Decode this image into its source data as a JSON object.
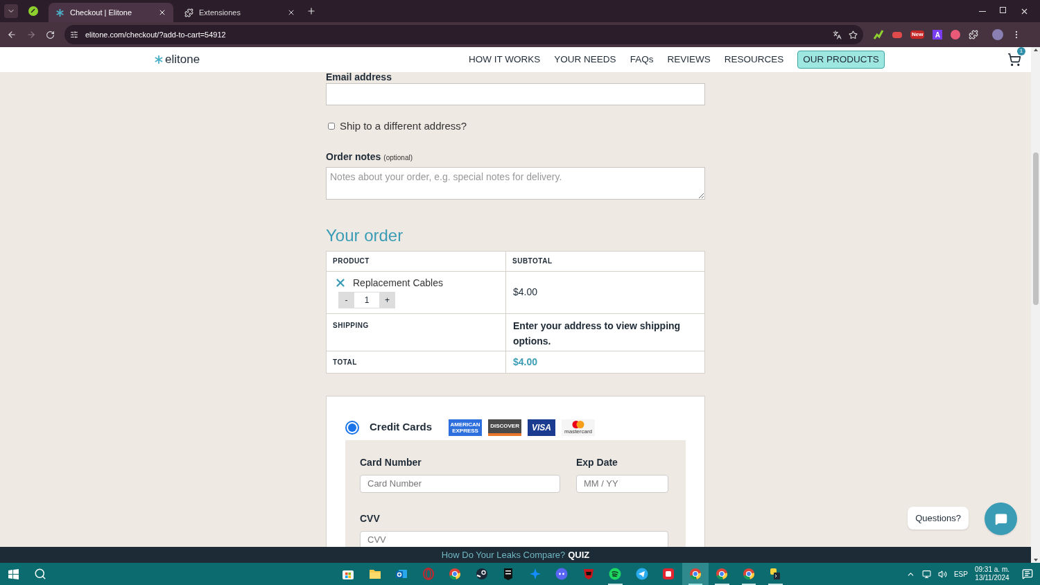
{
  "browser": {
    "tabs": [
      {
        "title": "Checkout | Elitone",
        "selected": true
      },
      {
        "title": "Extensiones",
        "selected": false
      }
    ],
    "url": "elitone.com/checkout/?add-to-cart=54912",
    "extension_badge": "New",
    "extension_letter": "A"
  },
  "site": {
    "logo": "elitone",
    "nav": [
      {
        "label": "HOW IT WORKS",
        "kind": "link"
      },
      {
        "label": "YOUR NEEDS",
        "kind": "link"
      },
      {
        "label": "FAQs",
        "kind": "link"
      },
      {
        "label": "REVIEWS",
        "kind": "link"
      },
      {
        "label": "RESOURCES",
        "kind": "link"
      },
      {
        "label": "OUR PRODUCTS",
        "kind": "button"
      }
    ],
    "cart_count": "1"
  },
  "checkout": {
    "email_label": "Email address",
    "ship_different": {
      "label": "Ship to a different address?",
      "checked": false
    },
    "order_notes": {
      "label": "Order notes",
      "hint": "(optional)",
      "placeholder": "Notes about your order, e.g. special notes for delivery."
    }
  },
  "order": {
    "title": "Your order",
    "columns": [
      "PRODUCT",
      "SUBTOTAL"
    ],
    "item": {
      "name": "Replacement Cables",
      "minus": "-",
      "quantity": "1",
      "plus": "+",
      "subtotal": "$4.00"
    },
    "shipping": {
      "label": "SHIPPING",
      "value": "Enter your address to view shipping options."
    },
    "total": {
      "label": "TOTAL",
      "value": "$4.00"
    }
  },
  "payment": {
    "method": {
      "label": "Credit Cards",
      "selected": true
    },
    "card_logos": [
      {
        "kind": "amex",
        "text": "AMERICAN EXPRESS"
      },
      {
        "kind": "discover",
        "text": "DISCOVER"
      },
      {
        "kind": "visa",
        "text": "VISA"
      },
      {
        "kind": "mastercard",
        "text": "mastercard"
      }
    ],
    "fields": [
      {
        "label": "Card Number",
        "placeholder": "Card Number"
      },
      {
        "label": "Exp Date",
        "placeholder": "MM / YY"
      },
      {
        "label": "CVV",
        "placeholder": "CVV"
      }
    ]
  },
  "chat": {
    "label": "Questions?"
  },
  "banner": {
    "text": "How Do Your Leaks Compare?",
    "link": "QUIZ"
  },
  "taskbar": {
    "apps": [
      {
        "kind": "store",
        "open": false,
        "selected": false
      },
      {
        "kind": "folder",
        "open": false,
        "selected": false
      },
      {
        "kind": "mail",
        "open": false,
        "selected": false
      },
      {
        "kind": "ring",
        "open": false,
        "selected": false
      },
      {
        "kind": "browser",
        "open": false,
        "selected": false
      },
      {
        "kind": "steam",
        "open": false,
        "selected": false
      },
      {
        "kind": "epic",
        "open": false,
        "selected": false
      },
      {
        "kind": "star",
        "open": false,
        "selected": false
      },
      {
        "kind": "chat",
        "open": false,
        "selected": false
      },
      {
        "kind": "shield",
        "open": false,
        "selected": false
      },
      {
        "kind": "music",
        "open": true,
        "selected": false
      },
      {
        "kind": "send",
        "open": false,
        "selected": false
      },
      {
        "kind": "game",
        "open": false,
        "selected": false
      },
      {
        "kind": "browser",
        "open": true,
        "selected": true
      },
      {
        "kind": "browser",
        "open": true,
        "selected": false
      },
      {
        "kind": "browser",
        "open": true,
        "selected": false
      },
      {
        "kind": "terminal",
        "open": true,
        "selected": false
      }
    ],
    "language": "ESP",
    "time": "09:31 a. m.",
    "date": "13/11/2024"
  }
}
